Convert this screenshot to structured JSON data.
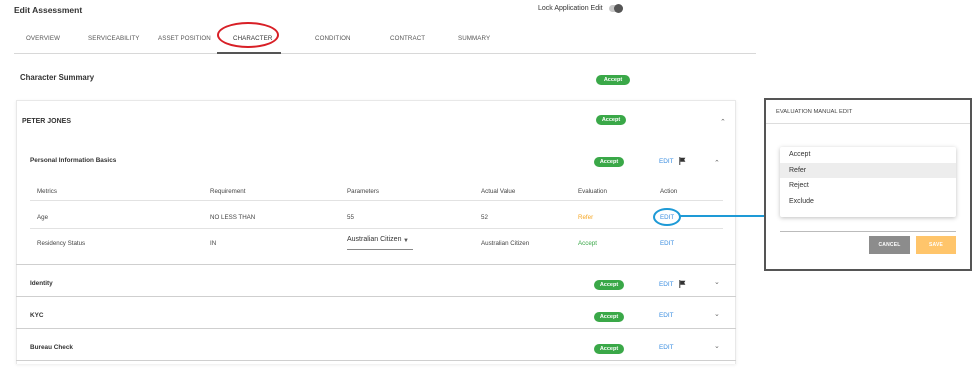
{
  "header": {
    "title": "Edit Assessment",
    "lock_label": "Lock Application Edit"
  },
  "tabs": [
    {
      "label": "OVERVIEW"
    },
    {
      "label": "SERVICEABILITY"
    },
    {
      "label": "ASSET POSITION"
    },
    {
      "label": "CHARACTER"
    },
    {
      "label": "CONDITION"
    },
    {
      "label": "CONTRACT"
    },
    {
      "label": "SUMMARY"
    }
  ],
  "summary": {
    "title": "Character Summary",
    "badge": "Accept"
  },
  "person": {
    "name": "PETER JONES",
    "badge": "Accept",
    "sections": {
      "personal": {
        "title": "Personal Information Basics",
        "badge": "Accept",
        "action": "EDIT"
      },
      "identity": {
        "title": "Identity",
        "badge": "Accept",
        "action": "EDIT"
      },
      "kyc": {
        "title": "KYC",
        "badge": "Accept",
        "action": "EDIT"
      },
      "bureau": {
        "title": "Bureau Check",
        "badge": "Accept",
        "action": "EDIT"
      }
    }
  },
  "table": {
    "headers": {
      "metrics": "Metrics",
      "requirement": "Requirement",
      "parameters": "Parameters",
      "actual": "Actual Value",
      "evaluation": "Evaluation",
      "action": "Action"
    },
    "rows": [
      {
        "metric": "Age",
        "requirement": "NO LESS THAN",
        "parameter": "55",
        "actual": "52",
        "evaluation": "Refer",
        "action": "EDIT"
      },
      {
        "metric": "Residency Status",
        "requirement": "IN",
        "parameter": "Australian Citizen",
        "actual": "Australian Citizen",
        "evaluation": "Accept",
        "action": "EDIT"
      }
    ]
  },
  "modal": {
    "title": "EVALUATION MANUAL EDIT",
    "options": [
      "Accept",
      "Refer",
      "Reject",
      "Exclude"
    ],
    "selected": "Refer",
    "cancel": "CANCEL",
    "save": "SAVE"
  },
  "colors": {
    "accept": "#3aa848",
    "refer": "#f5a623",
    "link": "#3a8de0",
    "highlight_red": "#d81f26",
    "highlight_blue": "#1e9ad6"
  }
}
